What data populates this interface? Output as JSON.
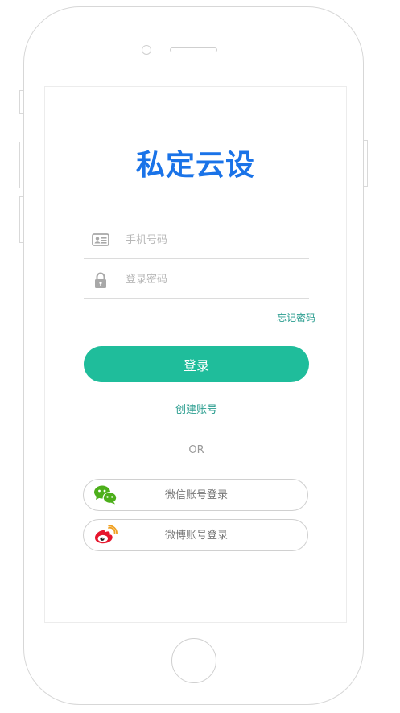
{
  "app": {
    "title": "私定云设",
    "title_color": "#1a73e8"
  },
  "form": {
    "phone": {
      "placeholder": "手机号码",
      "value": "",
      "icon": "id-card-icon"
    },
    "password": {
      "placeholder": "登录密码",
      "value": "",
      "icon": "lock-icon"
    },
    "forgot_label": "忘记密码",
    "login_label": "登录",
    "register_label": "创建账号",
    "accent_color": "#1fbd9b"
  },
  "divider": {
    "text": "OR"
  },
  "social": {
    "wechat": {
      "label": "微信账号登录",
      "icon": "wechat-icon",
      "color": "#4caf1a"
    },
    "weibo": {
      "label": "微博账号登录",
      "icon": "weibo-icon",
      "color": "#e6162d"
    }
  }
}
